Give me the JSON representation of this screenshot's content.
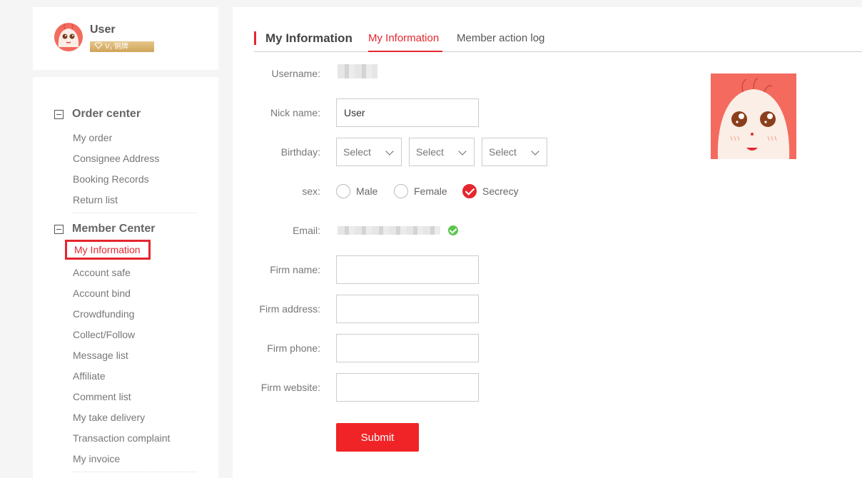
{
  "user": {
    "name": "User",
    "badge": "V₁ 铜牌"
  },
  "sidebar": {
    "groups": [
      {
        "title": "Order center",
        "items": [
          "My order",
          "Consignee Address",
          "Booking Records",
          "Return list"
        ]
      },
      {
        "title": "Member Center",
        "items": [
          "My Information",
          "Account safe",
          "Account bind",
          "Crowdfunding",
          "Collect/Follow",
          "Message list",
          "Affiliate",
          "Comment list",
          "My take delivery",
          "Transaction complaint",
          "My invoice"
        ]
      }
    ],
    "active_item": "My Information"
  },
  "tabs": {
    "title": "My Information",
    "items": [
      "My Information",
      "Member action log"
    ],
    "active": 0
  },
  "form": {
    "username_label": "Username:",
    "nickname_label": "Nick name:",
    "nickname_value": "User",
    "birthday_label": "Birthday:",
    "birthday_selects": [
      "Select",
      "Select",
      "Select"
    ],
    "sex_label": "sex:",
    "sex_options": [
      "Male",
      "Female",
      "Secrecy"
    ],
    "sex_selected": "Secrecy",
    "email_label": "Email:",
    "firm_name_label": "Firm name:",
    "firm_address_label": "Firm address:",
    "firm_phone_label": "Firm phone:",
    "firm_website_label": "Firm website:",
    "submit_label": "Submit"
  },
  "colors": {
    "accent": "#e4262e",
    "verified": "#5cc64f",
    "avatar_bg": "#f46a5e"
  },
  "icons": {
    "collapse": "minus-square-icon",
    "verified": "check-circle-icon",
    "dropdown": "chevron-down-icon",
    "badge": "diamond-icon"
  }
}
